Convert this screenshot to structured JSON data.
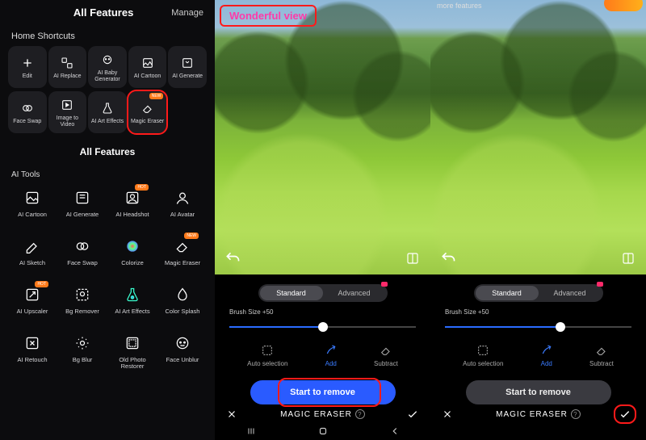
{
  "panel1": {
    "header": {
      "title": "All Features",
      "manage": "Manage"
    },
    "shortcuts_label": "Home Shortcuts",
    "shortcuts": [
      {
        "name": "edit",
        "label": "Edit"
      },
      {
        "name": "ai-replace",
        "label": "AI Replace"
      },
      {
        "name": "ai-baby",
        "label": "AI Baby Generator"
      },
      {
        "name": "ai-cartoon",
        "label": "AI Cartoon"
      },
      {
        "name": "ai-generate",
        "label": "AI Generate"
      },
      {
        "name": "face-swap",
        "label": "Face Swap"
      },
      {
        "name": "image-to-video",
        "label": "Image to Video"
      },
      {
        "name": "ai-art-effects",
        "label": "AI Art Effects"
      },
      {
        "name": "magic-eraser",
        "label": "Magic Eraser",
        "badge": "NEW"
      }
    ],
    "all_features_heading": "All Features",
    "category_label": "AI Tools",
    "tools": [
      {
        "name": "ai-cartoon",
        "label": "AI Cartoon"
      },
      {
        "name": "ai-generate",
        "label": "AI Generate"
      },
      {
        "name": "ai-headshot",
        "label": "AI Headshot",
        "badge": "HOT"
      },
      {
        "name": "ai-avatar",
        "label": "AI Avatar"
      },
      {
        "name": "ai-sketch",
        "label": "AI Sketch"
      },
      {
        "name": "face-swap",
        "label": "Face Swap"
      },
      {
        "name": "colorize",
        "label": "Colorize"
      },
      {
        "name": "magic-eraser",
        "label": "Magic Eraser",
        "badge": "NEW"
      },
      {
        "name": "ai-upscaler",
        "label": "AI Upscaler",
        "badge": "HOT"
      },
      {
        "name": "bg-remover",
        "label": "Bg Remover"
      },
      {
        "name": "ai-art-effects",
        "label": "AI Art Effects"
      },
      {
        "name": "color-splash",
        "label": "Color Splash"
      },
      {
        "name": "ai-retouch",
        "label": "AI Retouch"
      },
      {
        "name": "bg-blur",
        "label": "Bg Blur"
      },
      {
        "name": "old-photo",
        "label": "Old Photo Restorer"
      },
      {
        "name": "face-unblur",
        "label": "Face Unblur"
      }
    ]
  },
  "panel2": {
    "overlay_text": "Wonderful view",
    "tabs": {
      "standard": "Standard",
      "advanced": "Advanced"
    },
    "brush_label": "Brush Size +50",
    "slider_pct": 50,
    "modes": {
      "auto": "Auto selection",
      "add": "Add",
      "subtract": "Subtract"
    },
    "start_label": "Start to remove",
    "footer_title": "MAGIC ERASER"
  },
  "panel3": {
    "more_label": "more features",
    "tabs": {
      "standard": "Standard",
      "advanced": "Advanced"
    },
    "brush_label": "Brush Size +50",
    "slider_pct": 62,
    "modes": {
      "auto": "Auto selection",
      "add": "Add",
      "subtract": "Subtract"
    },
    "start_label": "Start to remove",
    "footer_title": "MAGIC ERASER"
  }
}
